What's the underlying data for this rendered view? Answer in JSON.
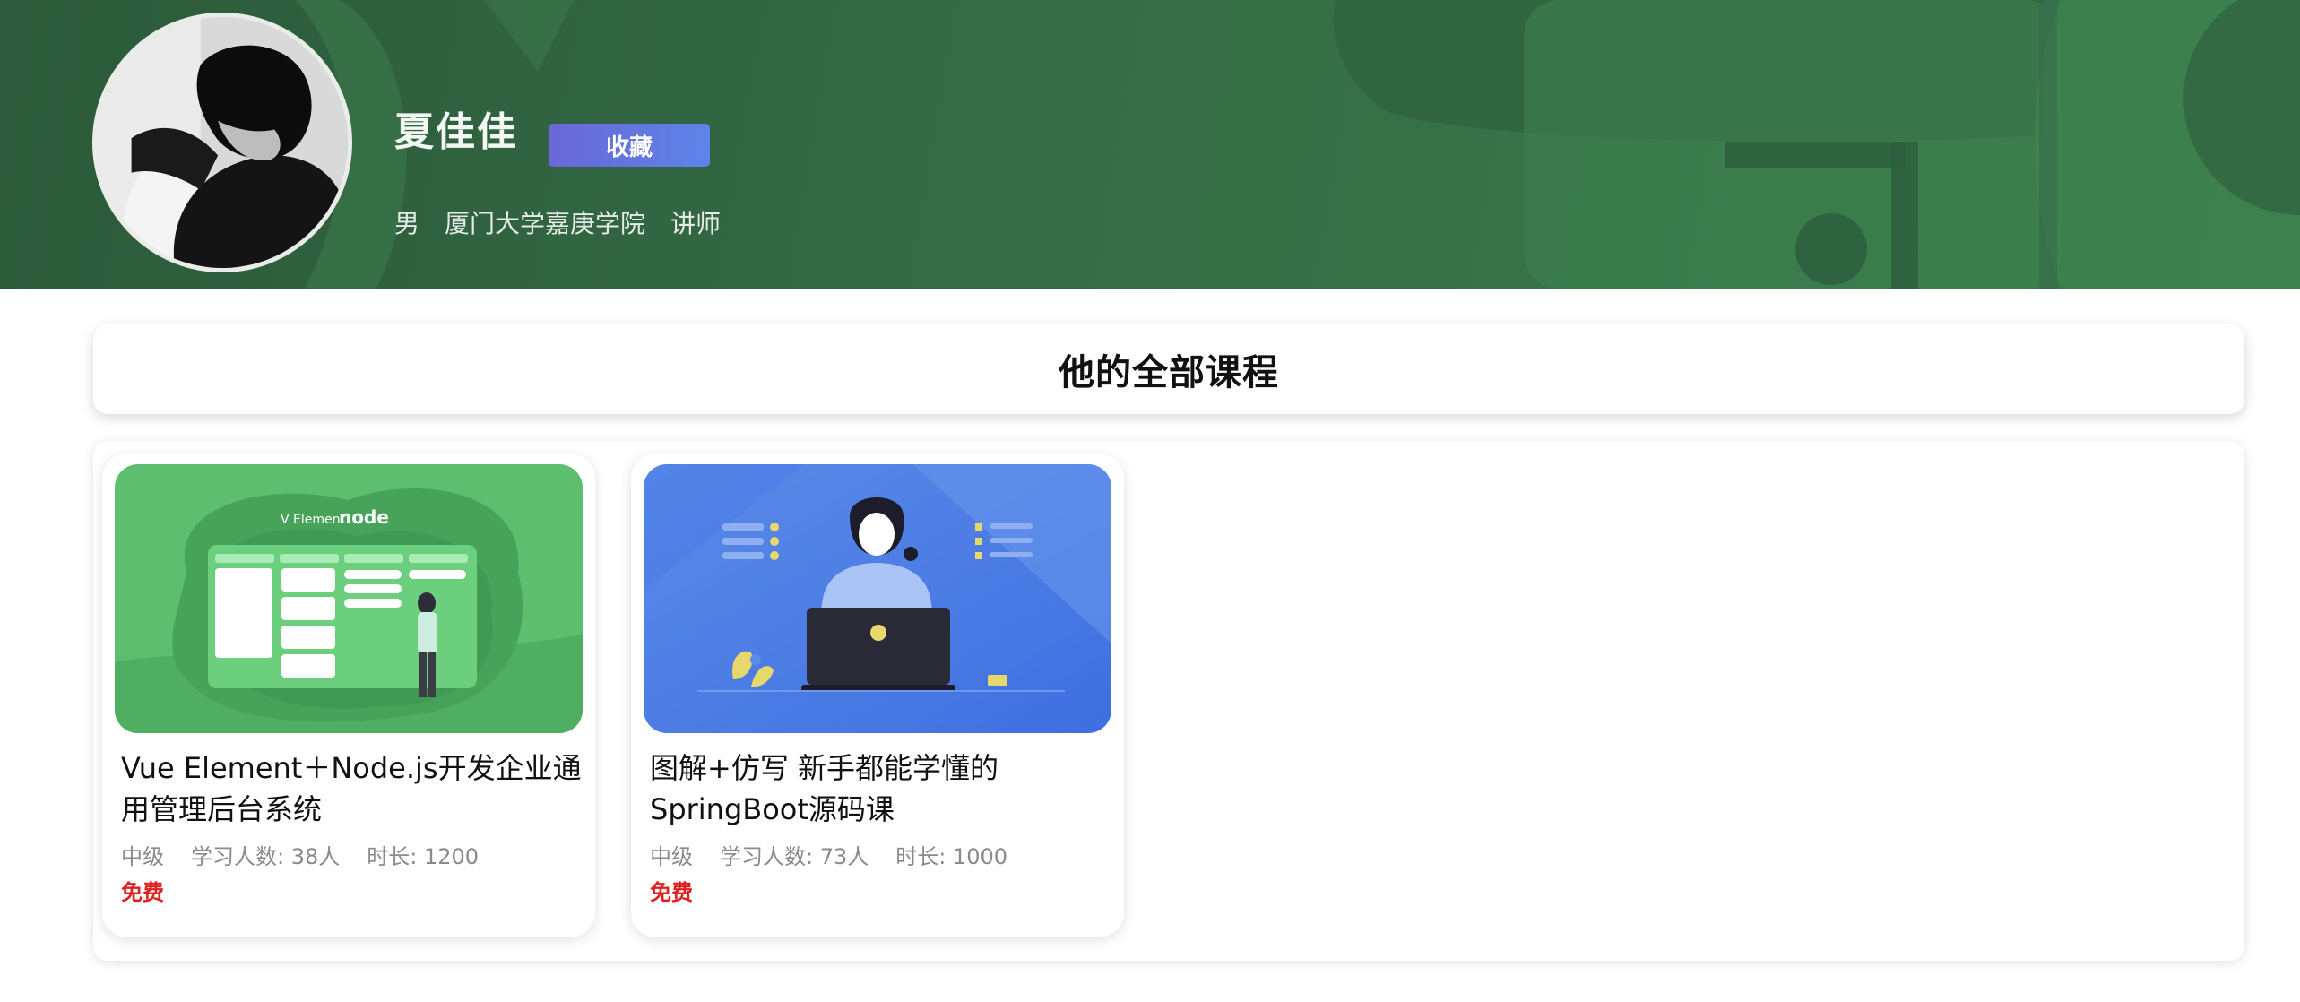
{
  "teacher": {
    "name": "夏佳佳",
    "favorite_label": "收藏",
    "gender": "男",
    "school": "厦门大学嘉庚学院",
    "title": "讲师",
    "avatar_icon": "person-portrait-icon"
  },
  "section": {
    "title": "他的全部课程"
  },
  "courses": [
    {
      "title": "Vue Element＋Node.js开发企业通用管理后台系统",
      "level": "中级",
      "learners": "学习人数: 38人",
      "duration": "时长: 1200",
      "price": "免费",
      "cover_icon": "element-node-dashboard-illustration"
    },
    {
      "title": "图解+仿写 新手都能学懂的SpringBoot源码课",
      "level": "中级",
      "learners": "学习人数: 73人",
      "duration": "时长: 1000",
      "price": "免费",
      "cover_icon": "person-laptop-illustration"
    }
  ],
  "colors": {
    "banner": "#356b45",
    "favorite_button": "#6a67d8",
    "price": "#e02020",
    "card_cover_1": "#55b86a",
    "card_cover_2": "#4f82e6"
  }
}
